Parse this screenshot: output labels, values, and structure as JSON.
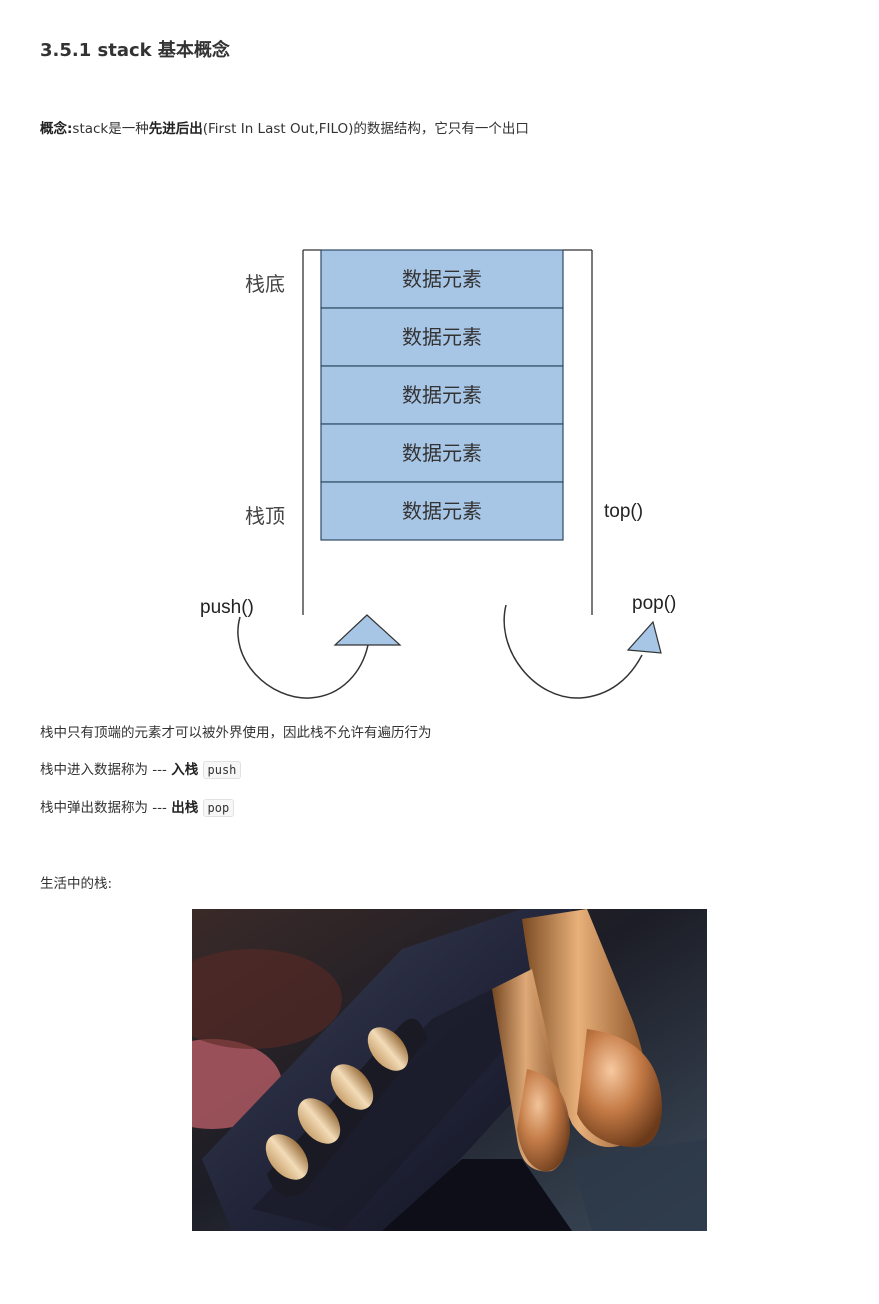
{
  "heading": "3.5.1 stack 基本概念",
  "concept": {
    "label": "概念:",
    "text_1": "stack是一种",
    "bold": "先进后出",
    "text_2": "(First In Last Out,FILO)的数据结构，它只有一个出口"
  },
  "diagram": {
    "cells": [
      "数据元素",
      "数据元素",
      "数据元素",
      "数据元素",
      "数据元素"
    ],
    "bottom_label": "栈底",
    "top_label": "栈顶",
    "top_func": "top()",
    "push_func": "push()",
    "pop_func": "pop()",
    "colors": {
      "cell_fill": "#a7c5e5",
      "cell_stroke": "#2f4a66",
      "line": "#333333"
    }
  },
  "note": "栈中只有顶端的元素才可以被外界使用，因此栈不允许有遍历行为",
  "push_line": {
    "text": "栈中进入数据称为 --- ",
    "bold": "入栈",
    "code": "push"
  },
  "pop_line": {
    "text": "栈中弹出数据称为 --- ",
    "bold": "出栈",
    "code": "pop"
  },
  "life": "生活中的栈:"
}
